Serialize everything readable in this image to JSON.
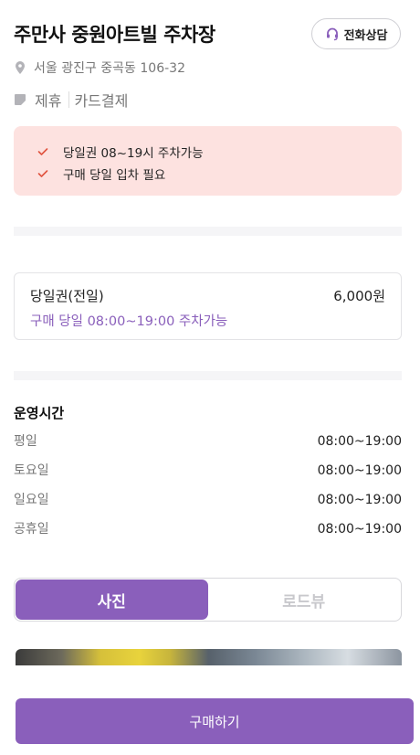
{
  "header": {
    "title": "주만사 중원아트빌 주차장",
    "call_button_label": "전화상담"
  },
  "address": "서울 광진구 중곡동 106-32",
  "tags": [
    "제휴",
    "카드결제"
  ],
  "notices": [
    "당일권 08~19시 주차가능",
    "구매 당일 입차 필요"
  ],
  "ticket": {
    "name": "당일권(전일)",
    "price": "6,000원",
    "description": "구매 당일 08:00~19:00 주차가능"
  },
  "hours": {
    "title": "운영시간",
    "rows": [
      {
        "day": "평일",
        "time": "08:00~19:00"
      },
      {
        "day": "토요일",
        "time": "08:00~19:00"
      },
      {
        "day": "일요일",
        "time": "08:00~19:00"
      },
      {
        "day": "공휴일",
        "time": "08:00~19:00"
      }
    ]
  },
  "tabs": [
    {
      "label": "사진",
      "active": true
    },
    {
      "label": "로드뷰",
      "active": false
    }
  ],
  "buy_button_label": "구매하기",
  "colors": {
    "accent": "#8a5fbb",
    "notice_bg": "#fde2e0",
    "check": "#e0533f"
  }
}
